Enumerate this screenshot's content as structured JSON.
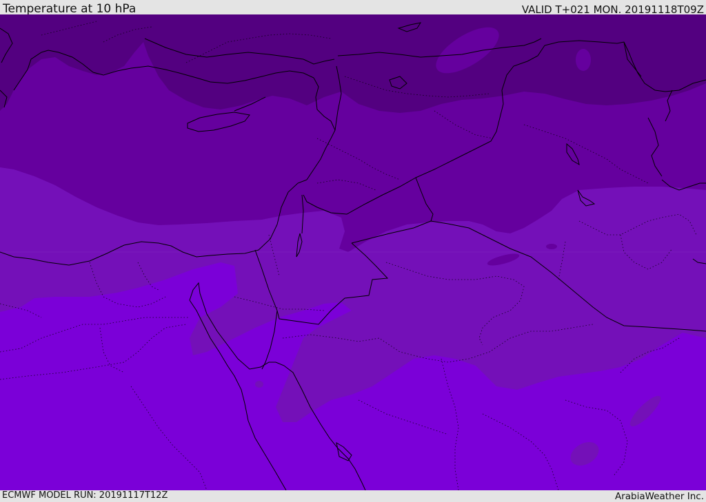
{
  "header": {
    "title": "Temperature at 10 hPa",
    "valid_time": "VALID T+021 MON. 20191118T09Z"
  },
  "footer": {
    "model_run": "ECMWF MODEL RUN: 20191117T12Z",
    "credit": "ArabiaWeather Inc."
  },
  "map": {
    "field": "temperature",
    "pressure_level_hpa": 10,
    "colors": {
      "band_coldest": "#530080",
      "band_cold": "#65009e",
      "band_mid": "#7410b8",
      "band_warm": "#7b00d8",
      "coastline": "#000000",
      "border": "#000000"
    }
  }
}
